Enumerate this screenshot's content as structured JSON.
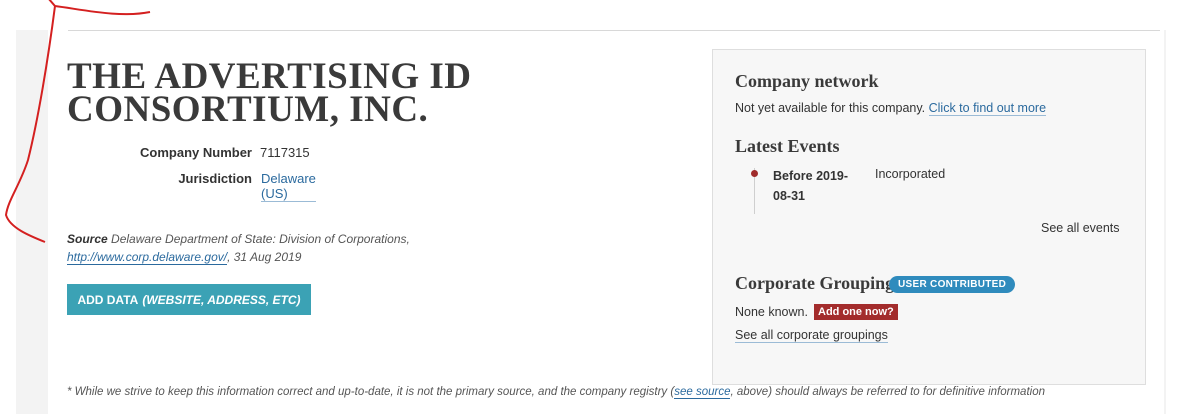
{
  "company": {
    "name": "THE ADVERTISING ID CONSORTIUM, INC.",
    "number_label": "Company Number",
    "number": "7117315",
    "jurisdiction_label": "Jurisdiction",
    "jurisdiction": "Delaware (US)"
  },
  "source": {
    "label": "Source",
    "text": "Delaware Department of State: Division of Corporations,",
    "link": "http://www.corp.delaware.gov/",
    "date": ", 31 Aug 2019"
  },
  "add_data_button": {
    "label": "ADD DATA",
    "suffix": "(WEBSITE, ADDRESS, ETC)"
  },
  "disclaimer": {
    "before": "* While we strive to keep this information correct and up-to-date, it is not the primary source, and the company registry (",
    "link": "see source",
    "after": ", above) should always be referred to for definitive information"
  },
  "panel": {
    "network_heading": "Company network",
    "network_text": "Not yet available for this company.",
    "network_link": "Click to find out more",
    "events_heading": "Latest Events",
    "event_date_1": "Before 2019-",
    "event_date_2": "08-31",
    "event_desc": "Incorporated",
    "see_all_events": "See all events",
    "grouping_heading": "Corporate Grouping",
    "grouping_badge": "USER CONTRIBUTED",
    "grouping_none": "None known.",
    "add_one_now": "Add one now?",
    "see_all_groupings": "See all corporate groupings"
  },
  "colors": {
    "link": "#2b6a9e",
    "button": "#3ba2b5",
    "badge": "#2f8bbd",
    "alert": "#a32c2c",
    "annotation": "#d42020"
  }
}
